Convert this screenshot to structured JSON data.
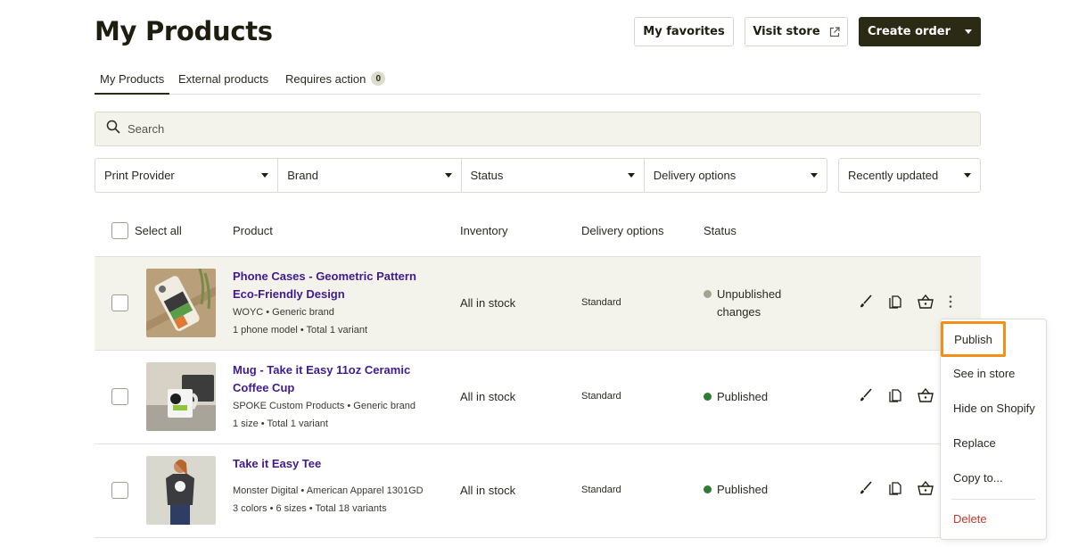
{
  "header": {
    "title": "My Products",
    "favorites_label": "My favorites",
    "visit_store_label": "Visit store",
    "create_order_label": "Create order"
  },
  "tabs": [
    {
      "label": "My Products",
      "active": true
    },
    {
      "label": "External products"
    },
    {
      "label": "Requires action",
      "badge": "0"
    }
  ],
  "search": {
    "placeholder": "Search"
  },
  "filters": [
    {
      "label": "Print Provider"
    },
    {
      "label": "Brand"
    },
    {
      "label": "Status"
    },
    {
      "label": "Delivery options"
    }
  ],
  "sort": {
    "label": "Recently updated"
  },
  "table": {
    "select_all_label": "Select all",
    "headers": {
      "product": "Product",
      "inventory": "Inventory",
      "delivery": "Delivery options",
      "status": "Status"
    },
    "rows": [
      {
        "title": "Phone Cases - Geometric Pattern Eco-Friendly Design",
        "provider": "WOYC • Generic brand",
        "variants": "1 phone model • Total 1 variant",
        "inventory": "All in stock",
        "delivery": "Standard",
        "status": "Unpublished changes",
        "status_color": "#a3a394"
      },
      {
        "title": "Mug - Take it Easy 11oz Ceramic Coffee Cup",
        "provider": "SPOKE Custom Products • Generic brand",
        "variants": "1 size • Total 1 variant",
        "inventory": "All in stock",
        "delivery": "Standard",
        "status": "Published",
        "status_color": "#2e7d32"
      },
      {
        "title": "Take it Easy Tee",
        "provider": "Monster Digital • American Apparel 1301GD",
        "variants": "3 colors • 6 sizes • Total 18 variants",
        "inventory": "All in stock",
        "delivery": "Standard",
        "status": "Published",
        "status_color": "#2e7d32"
      }
    ]
  },
  "context_menu": {
    "items": [
      "Publish",
      "See in store",
      "Hide on Shopify",
      "Replace",
      "Copy to...",
      "Delete"
    ]
  },
  "colors": {
    "accent": "#2b2a14",
    "highlight": "#f28f1b",
    "link": "#3f1b8e",
    "danger": "#c0392b"
  }
}
